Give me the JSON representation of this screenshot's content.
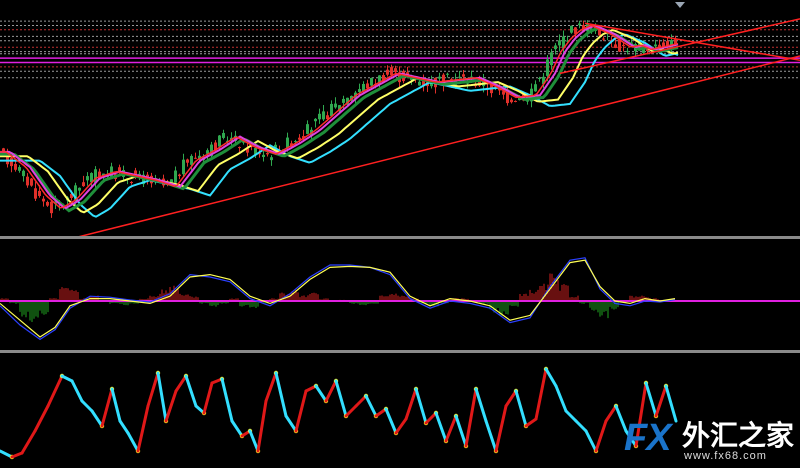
{
  "chart_data": [
    {
      "type": "line",
      "panel": "price",
      "colors": {
        "bull_candle": "#2fa84f",
        "bear_candle": "#e0302a",
        "ma_fast": "#ff2b2b",
        "ma_mid": "#1f8f3a",
        "ma_magenta": "#e040e0",
        "ma_yellow": "#ffff66",
        "ma_cyan": "#33e0ff",
        "trendline": "#ff2020",
        "hline_magenta": "#e020e0",
        "hline_dotted": "#9a9a9a",
        "hline_dotted_red": "#c03030"
      },
      "ylim": [
        0,
        100
      ],
      "price_path_x": [
        0,
        20,
        40,
        55,
        70,
        90,
        110,
        130,
        150,
        170,
        190,
        210,
        230,
        250,
        270,
        290,
        310,
        330,
        350,
        370,
        390,
        410,
        430,
        450,
        470,
        490,
        510,
        530,
        545,
        555,
        565,
        575,
        585,
        595,
        605,
        615,
        625,
        635,
        645,
        655,
        665,
        675
      ],
      "price_path_y": [
        34,
        27,
        14,
        8,
        12,
        22,
        25,
        23,
        21,
        18,
        30,
        35,
        41,
        36,
        33,
        38,
        44,
        52,
        60,
        65,
        70,
        68,
        66,
        67,
        68,
        64,
        59,
        60,
        70,
        80,
        86,
        90,
        92,
        90,
        88,
        85,
        82,
        83,
        81,
        82,
        83,
        84
      ],
      "trendline_main": [
        [
          0,
          -14
        ],
        [
          800,
          78
        ]
      ],
      "trendline_upper": [
        [
          585,
          93
        ],
        [
          800,
          76
        ]
      ],
      "trendline_lower": [
        [
          560,
          70
        ],
        [
          800,
          95
        ]
      ],
      "hlines_magenta": [
        75,
        77
      ],
      "hlines_dotted": [
        94,
        92,
        90,
        87,
        85,
        82,
        80,
        79,
        73,
        71,
        68
      ]
    },
    {
      "type": "bar",
      "panel": "macd",
      "colors": {
        "pos_hist": "#d02020",
        "neg_hist": "#1fa21f",
        "zero": "#e020e0",
        "signal": "#ffff55",
        "main": "#2b40ff"
      },
      "ylim": [
        -1,
        1
      ],
      "hist_x": [
        0,
        10,
        20,
        30,
        40,
        50,
        60,
        70,
        80,
        90,
        100,
        110,
        120,
        130,
        140,
        150,
        160,
        170,
        180,
        190,
        200,
        210,
        220,
        230,
        240,
        250,
        260,
        270,
        280,
        290,
        300,
        310,
        320,
        330,
        340,
        350,
        360,
        370,
        380,
        390,
        400,
        410,
        420,
        430,
        440,
        450,
        460,
        470,
        480,
        490,
        500,
        510,
        520,
        530,
        540,
        550,
        560,
        570,
        580,
        590,
        600,
        610,
        620,
        630,
        640,
        650,
        660,
        670
      ],
      "hist_values": [
        0.05,
        -0.05,
        -0.3,
        -0.4,
        -0.25,
        0.05,
        0.25,
        0.2,
        0.05,
        0.1,
        0.0,
        -0.05,
        -0.08,
        -0.05,
        0.05,
        0.1,
        0.2,
        0.3,
        0.15,
        0.1,
        -0.05,
        -0.1,
        -0.05,
        0.05,
        -0.1,
        -0.15,
        -0.05,
        0.05,
        0.15,
        0.2,
        0.1,
        0.15,
        0.05,
        0.0,
        0.02,
        -0.05,
        -0.08,
        -0.05,
        0.1,
        0.15,
        0.1,
        0.05,
        -0.05,
        -0.1,
        -0.05,
        0.05,
        0.05,
        0.0,
        -0.05,
        -0.2,
        -0.3,
        -0.1,
        0.15,
        0.2,
        0.3,
        0.5,
        0.3,
        0.1,
        -0.05,
        -0.2,
        -0.3,
        -0.15,
        0.0,
        0.1,
        0.1,
        0.05,
        0.0,
        0.02
      ],
      "signal_x": [
        0,
        20,
        40,
        55,
        70,
        90,
        110,
        130,
        150,
        170,
        190,
        210,
        230,
        250,
        270,
        290,
        310,
        330,
        350,
        370,
        390,
        410,
        430,
        450,
        470,
        490,
        510,
        530,
        550,
        570,
        585,
        600,
        615,
        630,
        645,
        660,
        675
      ],
      "signal_values": [
        -0.05,
        -0.4,
        -0.75,
        -0.55,
        -0.1,
        0.05,
        0.05,
        0.0,
        -0.05,
        0.1,
        0.5,
        0.55,
        0.45,
        0.1,
        -0.05,
        0.1,
        0.45,
        0.7,
        0.72,
        0.7,
        0.6,
        0.1,
        -0.1,
        0.05,
        0.0,
        -0.1,
        -0.4,
        -0.3,
        0.25,
        0.8,
        0.85,
        0.3,
        0.0,
        -0.05,
        0.05,
        0.0,
        0.05
      ],
      "main_values": [
        -0.1,
        -0.5,
        -0.8,
        -0.6,
        -0.15,
        0.1,
        0.08,
        0.02,
        -0.02,
        0.15,
        0.55,
        0.5,
        0.4,
        0.05,
        -0.1,
        0.15,
        0.5,
        0.75,
        0.75,
        0.7,
        0.55,
        0.05,
        -0.15,
        0.0,
        -0.05,
        -0.15,
        -0.45,
        -0.35,
        0.3,
        0.85,
        0.9,
        0.25,
        -0.05,
        -0.1,
        0.0,
        -0.02,
        0.03
      ]
    },
    {
      "type": "line",
      "panel": "oscillator",
      "colors": {
        "rising": "#e01818",
        "falling": "#33dfff",
        "turn": "#ffee22"
      },
      "ylim": [
        0,
        100
      ],
      "x": [
        0,
        12,
        22,
        35,
        48,
        62,
        72,
        82,
        92,
        102,
        112,
        120,
        128,
        138,
        148,
        158,
        166,
        176,
        186,
        196,
        204,
        212,
        222,
        232,
        242,
        250,
        258,
        266,
        276,
        286,
        296,
        306,
        316,
        326,
        336,
        346,
        356,
        366,
        376,
        386,
        396,
        406,
        416,
        426,
        436,
        446,
        456,
        466,
        476,
        486,
        496,
        506,
        516,
        526,
        536,
        546,
        556,
        566,
        576,
        586,
        596,
        606,
        616,
        626,
        636,
        646,
        656,
        666,
        676
      ],
      "values": [
        10,
        4,
        8,
        30,
        55,
        85,
        80,
        60,
        50,
        35,
        72,
        40,
        28,
        10,
        55,
        88,
        40,
        70,
        85,
        55,
        48,
        78,
        82,
        40,
        25,
        30,
        10,
        60,
        88,
        45,
        30,
        70,
        75,
        60,
        80,
        45,
        55,
        65,
        45,
        52,
        28,
        42,
        72,
        38,
        48,
        20,
        45,
        15,
        72,
        40,
        10,
        55,
        70,
        35,
        42,
        92,
        75,
        50,
        40,
        30,
        10,
        40,
        55,
        30,
        15,
        78,
        45,
        75,
        40
      ]
    }
  ],
  "watermark": {
    "logo": "FX",
    "name_cn": "外汇之家",
    "url": "www.fx68.com"
  }
}
